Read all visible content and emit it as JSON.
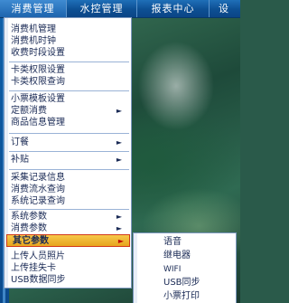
{
  "menubar": {
    "items": [
      {
        "label": "消费管理"
      },
      {
        "label": "水控管理"
      },
      {
        "label": "报表中心"
      },
      {
        "label": "设"
      }
    ]
  },
  "dropdown": {
    "items": [
      {
        "label": "消费机管理",
        "has_submenu": false
      },
      {
        "label": "消费机时钟",
        "has_submenu": false
      },
      {
        "label": "收费时段设置",
        "has_submenu": false
      },
      {
        "label": "卡类权限设置",
        "has_submenu": false
      },
      {
        "label": "卡类权限查询",
        "has_submenu": false
      },
      {
        "label": "小票模板设置",
        "has_submenu": false
      },
      {
        "label": "定额消费",
        "has_submenu": true
      },
      {
        "label": "商品信息管理",
        "has_submenu": false
      },
      {
        "label": "订餐",
        "has_submenu": true
      },
      {
        "label": "补贴",
        "has_submenu": true
      },
      {
        "label": "采集记录信息",
        "has_submenu": false
      },
      {
        "label": "消费流水查询",
        "has_submenu": false
      },
      {
        "label": "系统记录查询",
        "has_submenu": false
      },
      {
        "label": "系统参数",
        "has_submenu": true
      },
      {
        "label": "消费参数",
        "has_submenu": true
      },
      {
        "label": "其它参数",
        "has_submenu": true
      },
      {
        "label": "上传人员照片",
        "has_submenu": false
      },
      {
        "label": "上传挂失卡",
        "has_submenu": false
      },
      {
        "label": "USB数据同步",
        "has_submenu": false
      }
    ],
    "arrow": "►"
  },
  "submenu": {
    "items": [
      {
        "label": "语音"
      },
      {
        "label": "继电器"
      },
      {
        "label": "WIFI"
      },
      {
        "label": "USB同步"
      },
      {
        "label": "小票打印"
      }
    ]
  },
  "colors": {
    "menubar": "#0d4f93",
    "highlight": "#e7a41d",
    "highlight_border": "#d23a1a",
    "menu_text": "#1a2a55"
  }
}
